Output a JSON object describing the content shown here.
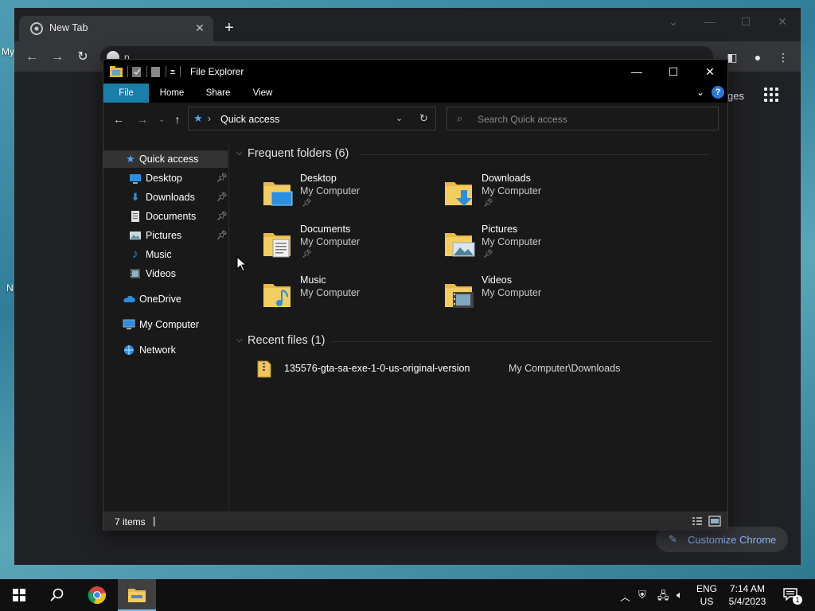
{
  "desktop": {
    "frag_top": "My",
    "frag_bottom": "N"
  },
  "chrome": {
    "tab_title": "New Tab",
    "omnibox_text": "p",
    "images_link": "ges",
    "customize_label": "Customize Chrome"
  },
  "explorer": {
    "title": "File Explorer",
    "ribbon_tabs": [
      "File",
      "Home",
      "Share",
      "View"
    ],
    "address": "Quick access",
    "search_placeholder": "Search Quick access",
    "nav": [
      {
        "label": "Quick access",
        "icon": "star-icon"
      },
      {
        "label": "Desktop",
        "icon": "desktop-icon",
        "pinned": true
      },
      {
        "label": "Downloads",
        "icon": "download-icon",
        "pinned": true
      },
      {
        "label": "Documents",
        "icon": "document-icon",
        "pinned": true
      },
      {
        "label": "Pictures",
        "icon": "pictures-icon",
        "pinned": true
      },
      {
        "label": "Music",
        "icon": "music-icon"
      },
      {
        "label": "Videos",
        "icon": "videos-icon"
      },
      {
        "label": "OneDrive",
        "icon": "cloud-icon"
      },
      {
        "label": "My Computer",
        "icon": "computer-icon"
      },
      {
        "label": "Network",
        "icon": "network-icon"
      }
    ],
    "frequent_header": "Frequent folders (6)",
    "folders": [
      {
        "name": "Desktop",
        "location": "My Computer",
        "pinned": true
      },
      {
        "name": "Downloads",
        "location": "My Computer",
        "pinned": true
      },
      {
        "name": "Documents",
        "location": "My Computer",
        "pinned": true
      },
      {
        "name": "Pictures",
        "location": "My Computer",
        "pinned": true
      },
      {
        "name": "Music",
        "location": "My Computer",
        "pinned": false
      },
      {
        "name": "Videos",
        "location": "My Computer",
        "pinned": false
      }
    ],
    "recent_header": "Recent files (1)",
    "recent": [
      {
        "name": "135576-gta-sa-exe-1-0-us-original-version",
        "path": "My Computer\\Downloads"
      }
    ],
    "status_count": "7 items"
  },
  "taskbar": {
    "lang_top": "ENG",
    "lang_bottom": "US",
    "time": "7:14 AM",
    "date": "5/4/2023",
    "notification_count": "1"
  },
  "colors": {
    "accent": "#1a7fa8",
    "chrome_link": "#8ab4f8",
    "explorer_bg": "#191919"
  }
}
